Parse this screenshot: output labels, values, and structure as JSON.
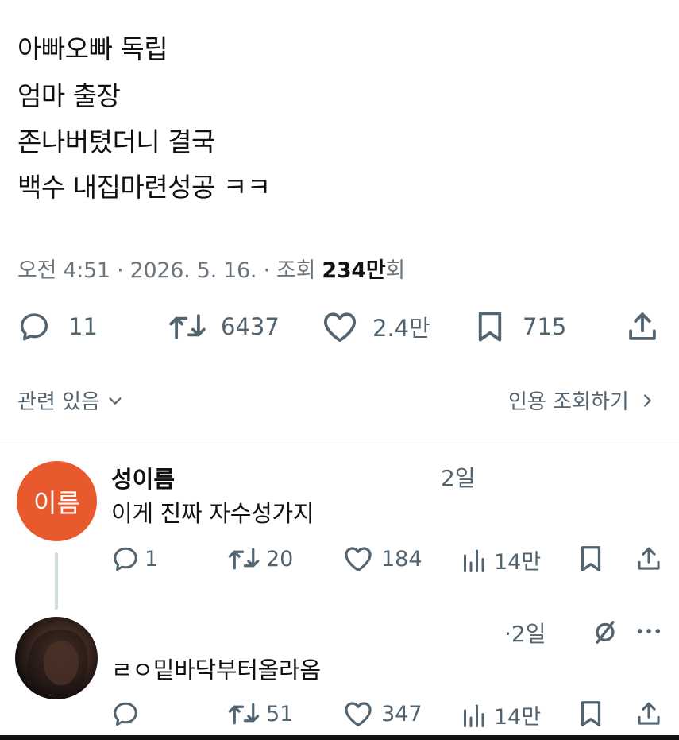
{
  "tweet": {
    "lines": [
      "아빠오빠 독립",
      "엄마 출장",
      "존나버텼더니 결국",
      "백수 내집마련성공 ㅋㅋ"
    ],
    "meta_prefix": "오전 4:51 · 2026. 5. 16. · 조회 ",
    "views_bold": "234만",
    "views_suffix": "회",
    "actions": {
      "replies": "11",
      "retweets": "6437",
      "likes": "2.4만",
      "bookmarks": "715"
    }
  },
  "related": {
    "label": "관련 있음",
    "quote_views": "인용 조회하기"
  },
  "replies": [
    {
      "avatar_text": "이름",
      "name": "성이름",
      "time": "2일",
      "text": "이게 진짜 자수성가지",
      "actions": {
        "replies": "1",
        "retweets": "20",
        "likes": "184",
        "views": "14만"
      }
    },
    {
      "time": "·2일",
      "text": "ㄹㅇ밑바닥부터올라옴",
      "actions": {
        "replies": "",
        "retweets": "51",
        "likes": "347",
        "views": "14만"
      }
    }
  ],
  "icons": [
    "reply-icon",
    "retweet-icon",
    "heart-icon",
    "bookmark-icon",
    "share-icon",
    "views-icon",
    "grok-icon",
    "more-icon",
    "chevron-down-icon",
    "chevron-right-icon"
  ]
}
